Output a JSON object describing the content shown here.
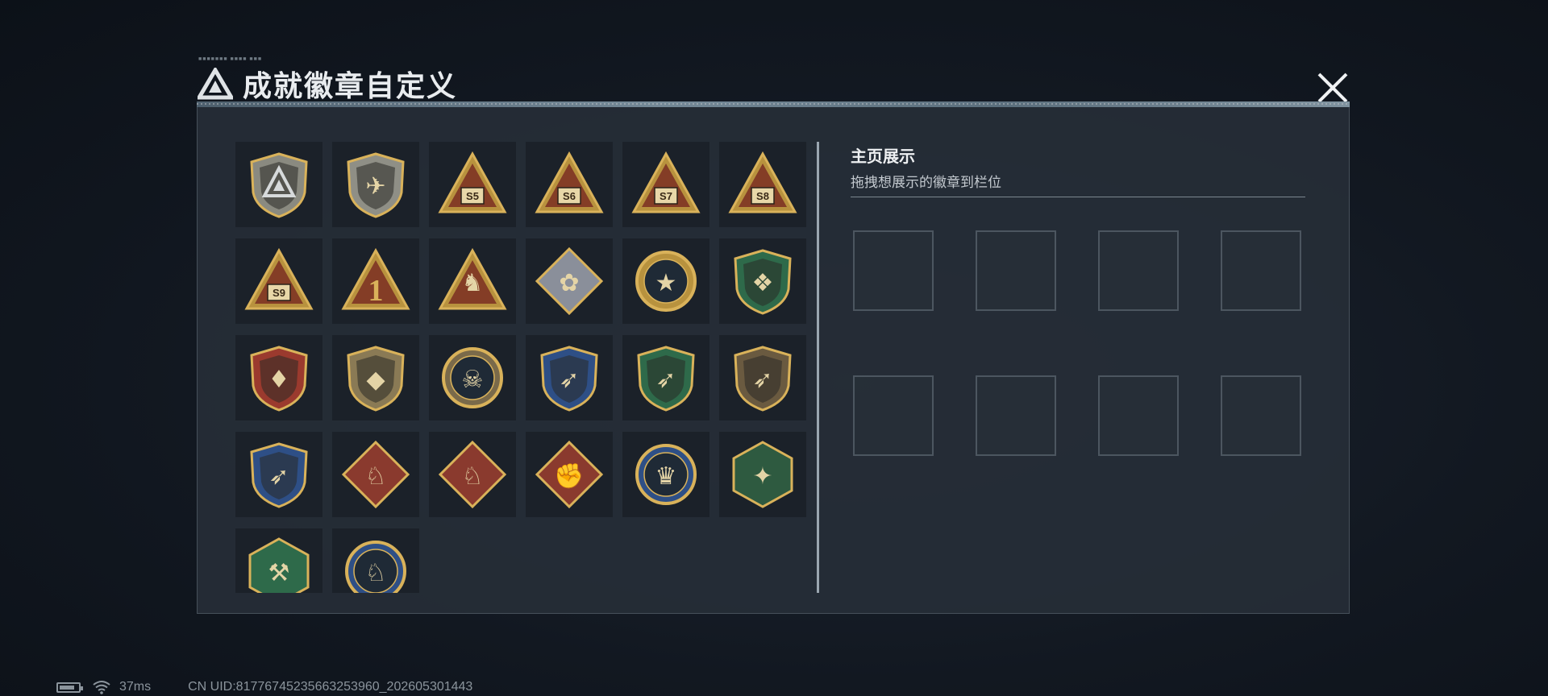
{
  "dialog": {
    "title": "成就徽章自定义",
    "close_label": "×"
  },
  "showcase": {
    "title": "主页展示",
    "subtitle": "拖拽想展示的徽章到栏位",
    "slot_count": 8
  },
  "badges": [
    {
      "name": "badge-shield-logo",
      "kind": "shield",
      "color": "#8a8a80",
      "glyph": "logo"
    },
    {
      "name": "badge-helicopter",
      "kind": "shield",
      "color": "#8f8f86",
      "glyph": "heli"
    },
    {
      "name": "badge-s5",
      "kind": "triangle",
      "color": "#b8923e",
      "glyph": "S5"
    },
    {
      "name": "badge-s6",
      "kind": "triangle",
      "color": "#b8923e",
      "glyph": "S6"
    },
    {
      "name": "badge-s7",
      "kind": "triangle",
      "color": "#b8923e",
      "glyph": "S7"
    },
    {
      "name": "badge-s8",
      "kind": "triangle",
      "color": "#b8923e",
      "glyph": "S8"
    },
    {
      "name": "badge-s9",
      "kind": "triangle",
      "color": "#b8923e",
      "glyph": "S9"
    },
    {
      "name": "badge-rank-1",
      "kind": "triangle",
      "color": "#b8923e",
      "glyph": "1"
    },
    {
      "name": "badge-soldiers",
      "kind": "triangle",
      "color": "#b8923e",
      "glyph": "squad"
    },
    {
      "name": "badge-rose",
      "kind": "diamond",
      "color": "#8a8f9a",
      "glyph": "rose"
    },
    {
      "name": "badge-star-medal",
      "kind": "circle",
      "color": "#b8923e",
      "glyph": "star"
    },
    {
      "name": "badge-green-shield",
      "kind": "shield",
      "color": "#2e6a4a",
      "glyph": "wing"
    },
    {
      "name": "badge-red-shield-wreath",
      "kind": "shield",
      "color": "#9b3a2e",
      "glyph": "wreath"
    },
    {
      "name": "badge-gem-shield",
      "kind": "shield",
      "color": "#8a7a55",
      "glyph": "gem"
    },
    {
      "name": "badge-skull-target",
      "kind": "circle",
      "color": "#7a6a4a",
      "glyph": "skull"
    },
    {
      "name": "badge-blue-rifle",
      "kind": "shield",
      "color": "#2e4f86",
      "glyph": "rifle"
    },
    {
      "name": "badge-green-rifle",
      "kind": "shield",
      "color": "#2e6a4a",
      "glyph": "rifle"
    },
    {
      "name": "badge-brown-rifle",
      "kind": "shield",
      "color": "#6a5a40",
      "glyph": "rifle"
    },
    {
      "name": "badge-blue-sniper",
      "kind": "shield",
      "color": "#2e4f86",
      "glyph": "rifle"
    },
    {
      "name": "badge-wolf-1",
      "kind": "diamond",
      "color": "#8a3a2e",
      "glyph": "wolf"
    },
    {
      "name": "badge-wolf-2",
      "kind": "diamond",
      "color": "#8a3a2e",
      "glyph": "wolf"
    },
    {
      "name": "badge-fist",
      "kind": "diamond",
      "color": "#8a3a2e",
      "glyph": "fist"
    },
    {
      "name": "badge-eagle",
      "kind": "circle",
      "color": "#2e4f86",
      "glyph": "eagle"
    },
    {
      "name": "badge-hornet",
      "kind": "hexagon",
      "color": "#2e5a40",
      "glyph": "hornet"
    },
    {
      "name": "badge-green-hammer",
      "kind": "hexagon",
      "color": "#2e6a4a",
      "glyph": "hammer"
    },
    {
      "name": "badge-blue-wolf",
      "kind": "circle",
      "color": "#2e4f86",
      "glyph": "wolf"
    }
  ],
  "status": {
    "ping": "37ms",
    "uid": "CN UID:81776745235663253960_202605301443"
  }
}
